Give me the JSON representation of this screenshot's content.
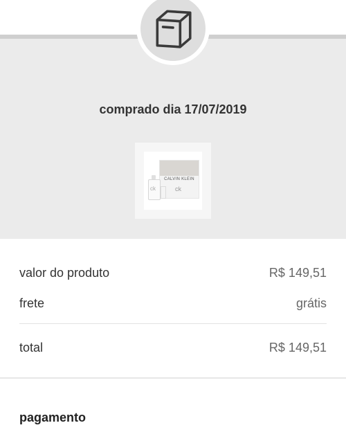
{
  "order": {
    "purchase_date": "comprado dia 17/07/2019",
    "icon": "package-icon"
  },
  "product": {
    "brand": "CALVIN KLEIN",
    "mark": "ck"
  },
  "summary": {
    "product_value_label": "valor do produto",
    "product_value": "R$ 149,51",
    "shipping_label": "frete",
    "shipping_value": "grátis",
    "total_label": "total",
    "total_value": "R$ 149,51"
  },
  "payment": {
    "title": "pagamento"
  },
  "colors": {
    "band": "#ebebeb",
    "stripe": "#cfcfcf",
    "text": "#333333"
  }
}
